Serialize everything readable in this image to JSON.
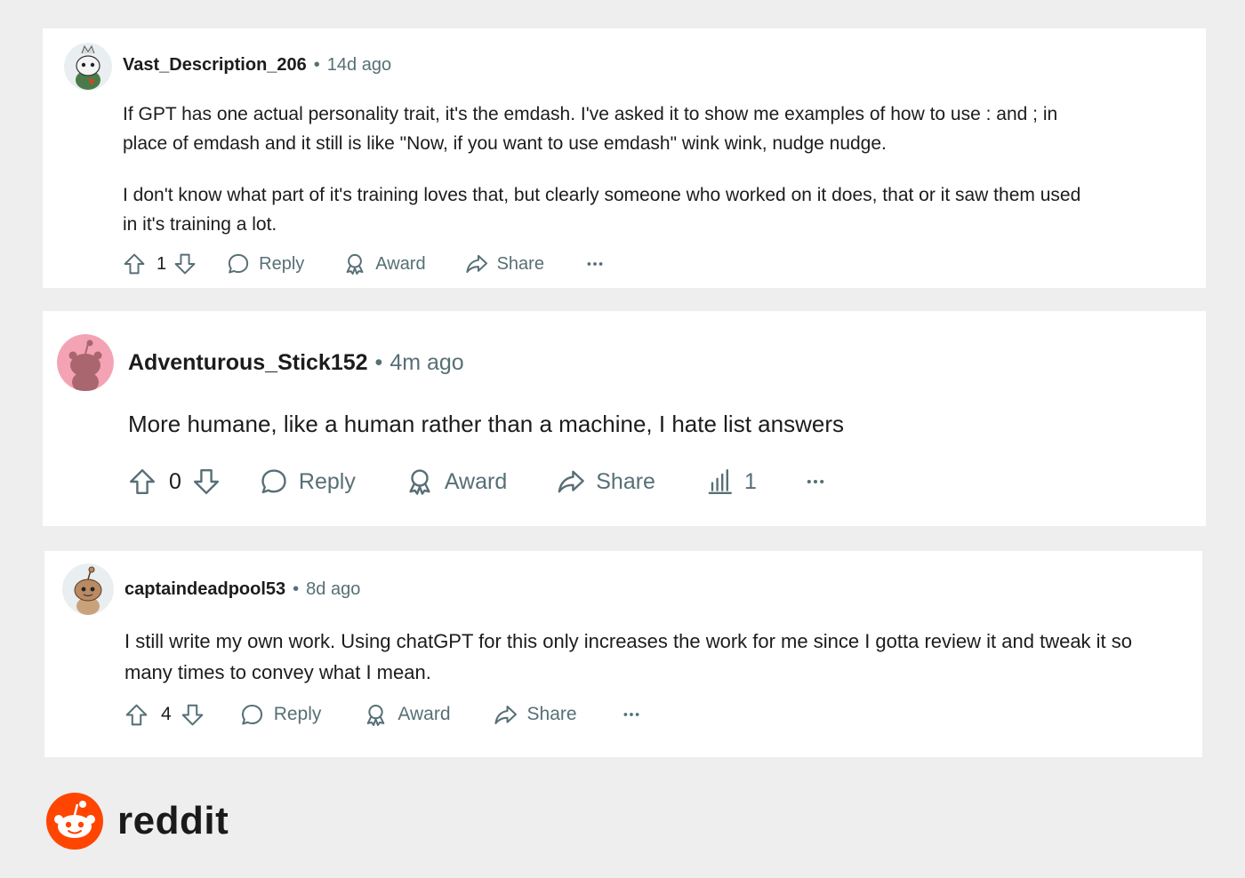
{
  "comments": [
    {
      "username": "Vast_Description_206",
      "separator": "•",
      "time": "14d ago",
      "paragraphs": [
        "If GPT has one actual personality trait, it's the emdash. I've asked it to show me examples of how to use : and ; in place of emdash and it still is like \"Now, if you want to use emdash\" wink wink, nudge nudge.",
        "I don't know what part of it's training loves that, but clearly someone who worked on it does, that or it saw them used in it's training a lot."
      ],
      "votes": "1",
      "reply_label": "Reply",
      "award_label": "Award",
      "share_label": "Share",
      "more_label": "···"
    },
    {
      "username": "Adventurous_Stick152",
      "separator": "•",
      "time": "4m ago",
      "paragraphs": [
        "More humane, like a human rather than a machine, I hate list answers"
      ],
      "votes": "0",
      "reply_label": "Reply",
      "award_label": "Award",
      "share_label": "Share",
      "insights_count": "1",
      "more_label": "···"
    },
    {
      "username": "captaindeadpool53",
      "separator": "•",
      "time": "8d ago",
      "paragraphs": [
        "I still write my own work. Using chatGPT for this only increases the work for me since I gotta review it and tweak it so many times to convey what I mean."
      ],
      "votes": "4",
      "reply_label": "Reply",
      "award_label": "Award",
      "share_label": "Share",
      "more_label": "···"
    }
  ],
  "brand": {
    "name": "reddit",
    "color": "#ff4500"
  },
  "colors": {
    "background": "#eeeeee",
    "card": "#ffffff",
    "meta": "#576f76",
    "avatar2_bg": "#f4a3b4"
  },
  "icons": [
    "upvote-icon",
    "downvote-icon",
    "reply-icon",
    "award-icon",
    "share-icon",
    "insights-icon",
    "more-icon",
    "reddit-logo-icon"
  ]
}
